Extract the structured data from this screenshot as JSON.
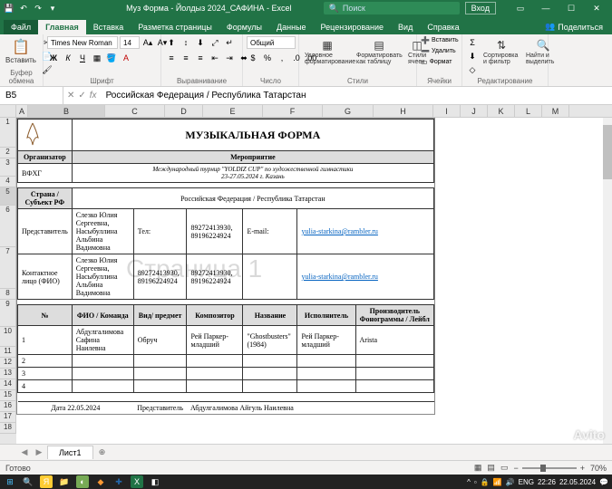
{
  "titlebar": {
    "title": "Муз Форма - Йолдыз 2024_САФИНА  -  Excel",
    "search_placeholder": "Поиск",
    "login": "Вход"
  },
  "tabs": {
    "file": "Файл",
    "home": "Главная",
    "insert": "Вставка",
    "pagelayout": "Разметка страницы",
    "formulas": "Формулы",
    "data": "Данные",
    "review": "Рецензирование",
    "view": "Вид",
    "help": "Справка",
    "share": "Поделиться"
  },
  "ribbon": {
    "clipboard": {
      "label": "Буфер обмена",
      "paste": "Вставить"
    },
    "font": {
      "label": "Шрифт",
      "name": "Times New Roman",
      "size": "14"
    },
    "align": {
      "label": "Выравнивание"
    },
    "number": {
      "label": "Число",
      "format": "Общий"
    },
    "styles": {
      "label": "Стили",
      "cond": "Условное форматирование",
      "table": "Форматировать как таблицу",
      "cell": "Стили ячеек"
    },
    "cells": {
      "label": "Ячейки",
      "insert": "Вставить",
      "delete": "Удалить",
      "format": "Формат"
    },
    "editing": {
      "label": "Редактирование",
      "sort": "Сортировка и фильтр",
      "find": "Найти и выделить"
    }
  },
  "formula": {
    "cell": "B5",
    "value": "Российская Федерация / Республика Татарстан"
  },
  "columns": [
    "A",
    "B",
    "C",
    "D",
    "E",
    "F",
    "G",
    "H",
    "I",
    "J",
    "K",
    "L",
    "M"
  ],
  "rows": [
    "1",
    "2",
    "3",
    "4",
    "5",
    "6",
    "7",
    "8",
    "9",
    "10",
    "11",
    "12",
    "13",
    "14",
    "15",
    "16",
    "17",
    "18"
  ],
  "doc": {
    "title": "МУЗЫКАЛЬНАЯ ФОРМА",
    "organizer_h": "Организатор",
    "event_h": "Мероприятие",
    "organizer": "ВФХГ",
    "event_line1": "Международный турнир \"YOLDIZ CUP\" по художественной гимнастики",
    "event_line2": "23-27.05.2024 г. Казань",
    "country_h": "Страна / Субъект РФ",
    "country": "Российская Федерация / Республика Татарстан",
    "rep_h": "Представитель",
    "rep_name": "Слезко Юлия Сергеевна, Насыбуллина Альбина Вадимовна",
    "tel_h": "Тел:",
    "tel": "89272413930, 89196224924",
    "email_h": "E-mail:",
    "email": "yulia-starkina@rambler.ru",
    "contact_h": "Контактное лицо (ФИО)",
    "contact_name": "Слезко Юлия Сергеевна, Насыбуллина Альбина Вадимовна",
    "contact_tel": "89272413930, 89196224924",
    "contact_tel2": "89272413930, 89196224924",
    "contact_email": "yulia-starkina@rambler.ru",
    "th_num": "№",
    "th_fio": "ФИО / Команда",
    "th_vid": "Вид/ предмет",
    "th_comp": "Композитор",
    "th_name": "Название",
    "th_perf": "Исполнитель",
    "th_prod": "Производитель Фонограммы / Лейбл",
    "r1_num": "1",
    "r1_fio": "Абдулгалимова Сафина Наилевна",
    "r1_vid": "Обруч",
    "r1_comp": "Рей Паркер-младший",
    "r1_name": "\"Ghostbusters\" (1984)",
    "r1_perf": "Рей Паркер-младший",
    "r1_prod": "Arista",
    "r2_num": "2",
    "r3_num": "3",
    "r4_num": "4",
    "date_label": "Дата 22.05.2024",
    "rep_label": "Представитель",
    "rep_footer": "Абдулгалимова Айгуль Наилевна",
    "watermark": "Страница 1"
  },
  "sheet": {
    "name": "Лист1"
  },
  "status": {
    "ready": "Готово",
    "zoom": "70%"
  },
  "taskbar": {
    "time": "22:26",
    "date": "22.05.2024",
    "lang": "ENG"
  },
  "avito": "Avito"
}
